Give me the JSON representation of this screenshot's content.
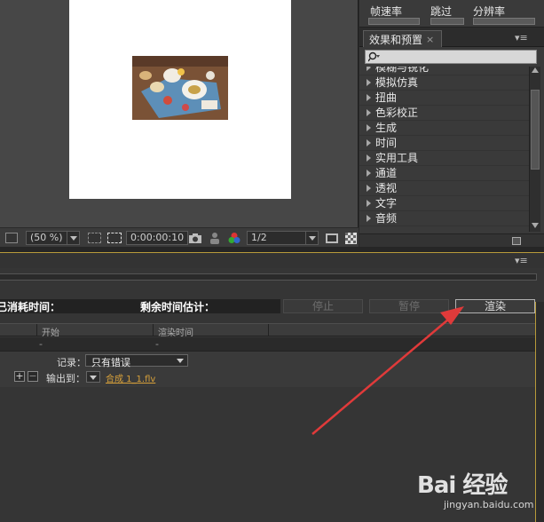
{
  "viewer": {
    "zoom": "(50 %)",
    "timecode": "0:00:00:10",
    "resolution": "1/2"
  },
  "right_top": {
    "frame_rate_label": "帧速率",
    "skip_label": "跳过",
    "resolution_label": "分辨率"
  },
  "effects_panel": {
    "title": "效果和预置",
    "tab_close": "×",
    "menu": "▾≡",
    "items": [
      {
        "label": "模糊与锐化"
      },
      {
        "label": "模拟仿真"
      },
      {
        "label": "扭曲"
      },
      {
        "label": "色彩校正"
      },
      {
        "label": "生成"
      },
      {
        "label": "时间"
      },
      {
        "label": "实用工具"
      },
      {
        "label": "通道"
      },
      {
        "label": "透视"
      },
      {
        "label": "文字"
      },
      {
        "label": "音频"
      }
    ]
  },
  "render_queue": {
    "menu": "▾≡",
    "elapsed_label": "已消耗时间：",
    "remaining_label": "剩余时间估计：",
    "stop_label": "停止",
    "pause_label": "暂停",
    "render_label": "渲染",
    "columns": {
      "start": "开始",
      "render_time": "渲染时间"
    },
    "row": {
      "dash1": "-",
      "dash2": "-"
    },
    "log_label": "记录：",
    "log_value": "只有错误",
    "output_label": "输出到：",
    "output_file": "合成 1_1.flv",
    "plus": "+",
    "minus": "−"
  },
  "watermark": {
    "text": "Bai 经验",
    "url": "jingyan.baidu.com"
  },
  "colors": {
    "accent_gold": "#b89a3a",
    "output_link": "#d8a13a",
    "arrow": "#e03a3a"
  }
}
